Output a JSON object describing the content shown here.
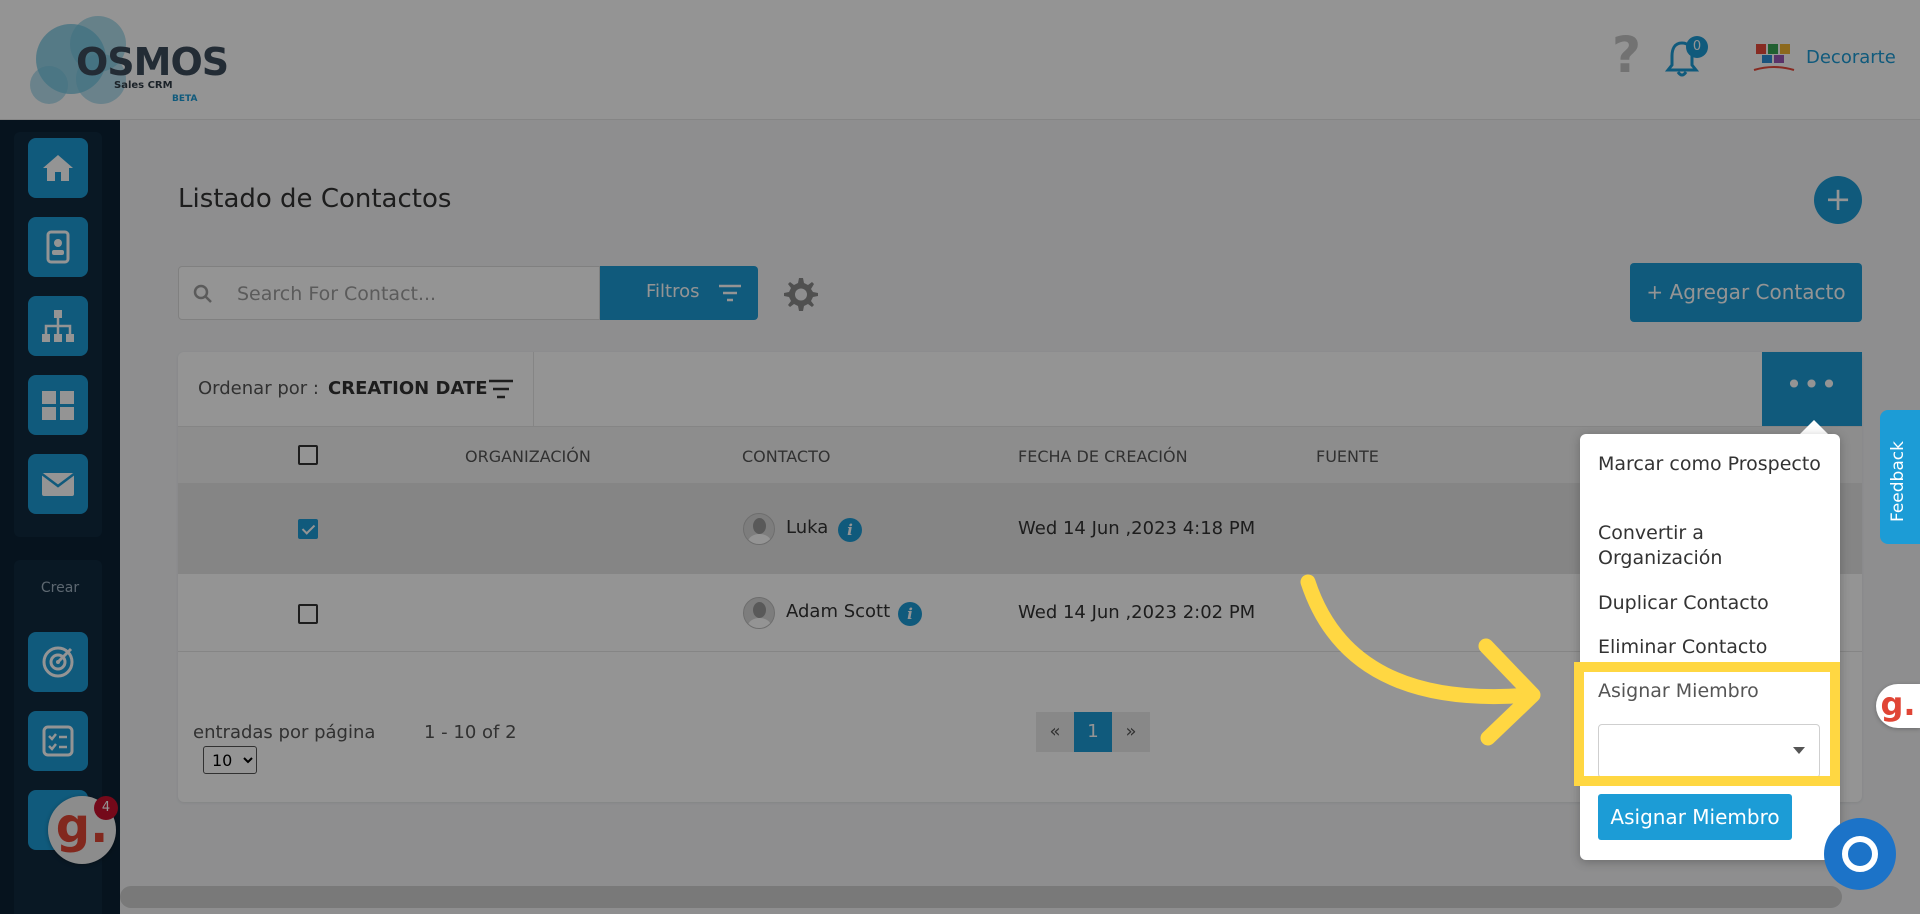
{
  "header": {
    "logo_word": "OSMOS",
    "logo_sub": "Sales CRM",
    "logo_beta": "BETA",
    "help_symbol": "?",
    "notifications_count": "0",
    "company_name": "Decorarte"
  },
  "sidebar": {
    "items": [
      {
        "icon": "home-icon"
      },
      {
        "icon": "contact-card-icon"
      },
      {
        "icon": "org-chart-icon"
      },
      {
        "icon": "grid-icon"
      },
      {
        "icon": "mail-icon"
      }
    ],
    "crear_label": "Crear",
    "create_items": [
      {
        "icon": "target-icon"
      },
      {
        "icon": "checklist-icon"
      }
    ]
  },
  "main": {
    "title": "Listado de Contactos",
    "add_symbol": "+",
    "search_placeholder": "Search For Contact...",
    "filter_label": "Filtros",
    "add_contact_label": "+ Agregar Contacto",
    "sort_label": "Ordenar por :",
    "sort_value": "CREATION DATE",
    "more_label": "•••",
    "columns": [
      "ORGANIZACIÓN",
      "CONTACTO",
      "FECHA DE CREACIÓN",
      "FUENTE"
    ],
    "rows": [
      {
        "checked": true,
        "contact": "Luka",
        "created": "Wed 14 Jun ,2023 4:18 PM"
      },
      {
        "checked": false,
        "contact": "Adam Scott",
        "created": "Wed 14 Jun ,2023 2:02 PM"
      }
    ],
    "per_page_label": "entradas por página",
    "per_page_value": "10",
    "range_label": "1 - 10 of 2",
    "pager": {
      "prev": "«",
      "current": "1",
      "next": "»"
    }
  },
  "menu": {
    "items": [
      "Marcar como Prospecto",
      "Convertir a Organización",
      "Duplicar Contacto",
      "Eliminar Contacto"
    ],
    "assign_label": "Asignar Miembro",
    "assign_button": "Asignar Miembro"
  },
  "widgets": {
    "feedback_label": "Feedback",
    "g_letter": "g.",
    "g_badge": "4"
  },
  "colors": {
    "accent": "#1c9cd6",
    "sidebar_bg": "#0c2234",
    "highlight": "#ffd742"
  }
}
